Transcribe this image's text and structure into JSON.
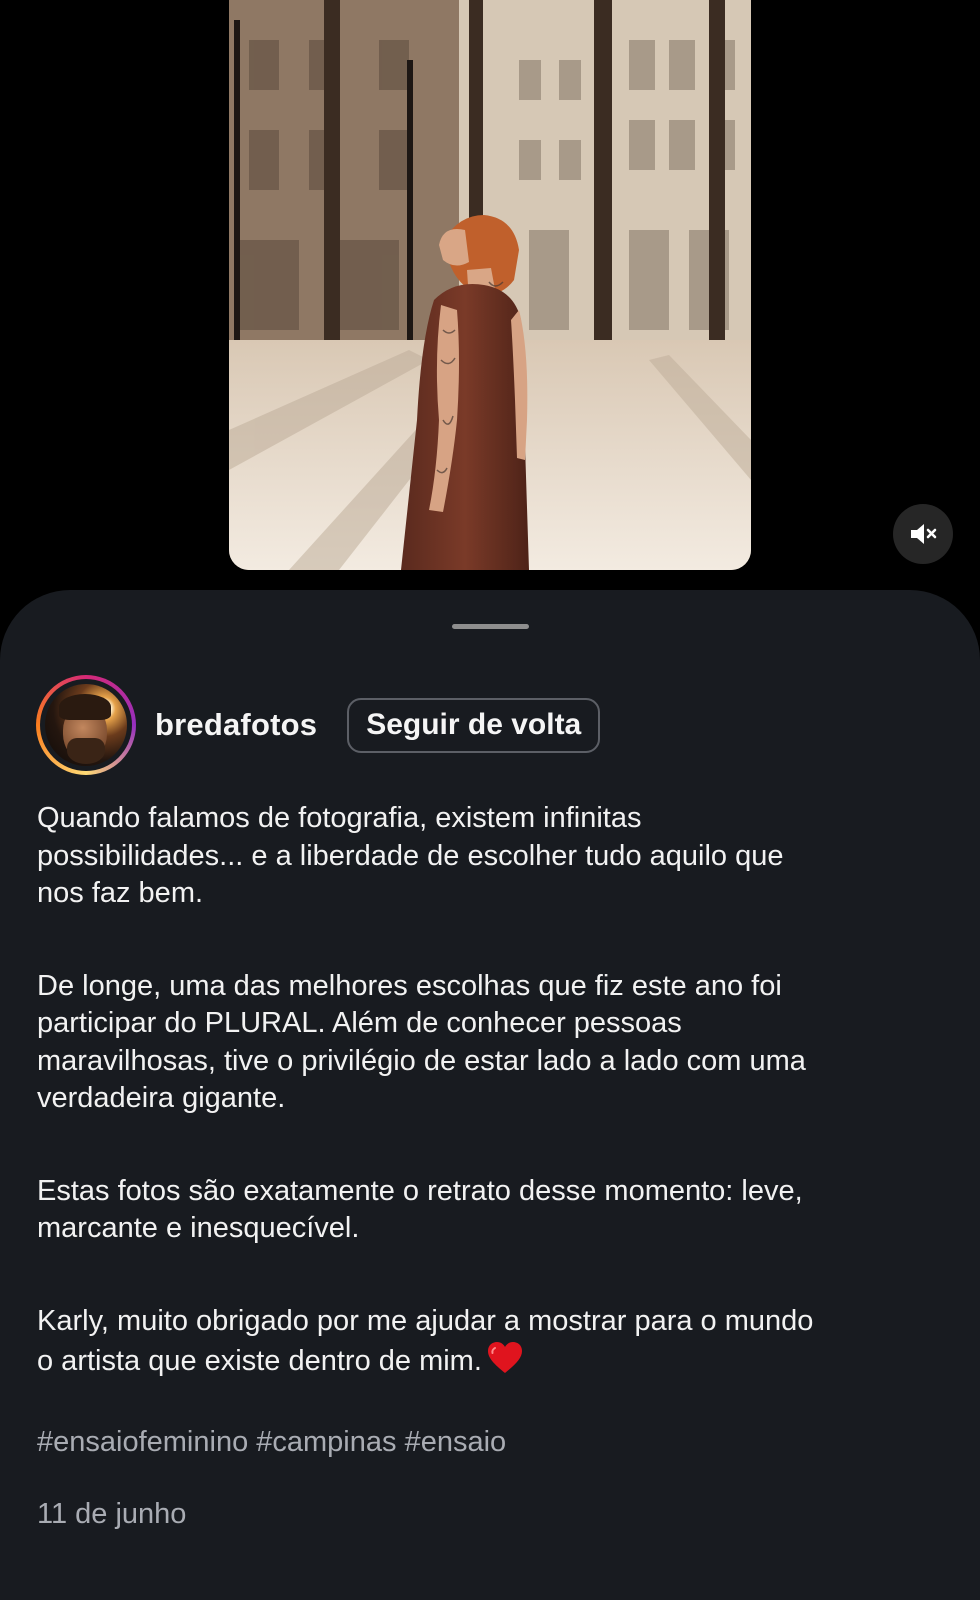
{
  "post": {
    "username": "bredafotos",
    "follow_label": "Seguir de volta",
    "caption": [
      "Quando falamos de fotografia, existem infinitas\npossibilidades... e a liberdade de escolher tudo aquilo que\nnos faz bem.",
      "De longe, uma das melhores escolhas que fiz este ano foi\nparticipar do PLURAL. Além de conhecer pessoas\nmaravilhosas, tive o privilégio de estar lado a lado com uma\nverdadeira gigante.",
      "Estas fotos são exatamente o retrato desse momento: leve,\nmarcante e inesquecível.",
      "Karly, muito obrigado por me ajudar a mostrar para o mundo\no artista que existe dentro de mim."
    ],
    "caption_emoji": "red-heart-emoji",
    "hashtags": [
      "#ensaiofeminino",
      "#campinas",
      "#ensaio"
    ],
    "date": "11 de junho"
  },
  "icons": {
    "mute": "speaker-muted-icon",
    "grabber": "sheet-grabber"
  },
  "colors": {
    "sheet_bg": "#181b20",
    "secondary_text": "#a9acb3",
    "heart": "#e0141e"
  }
}
